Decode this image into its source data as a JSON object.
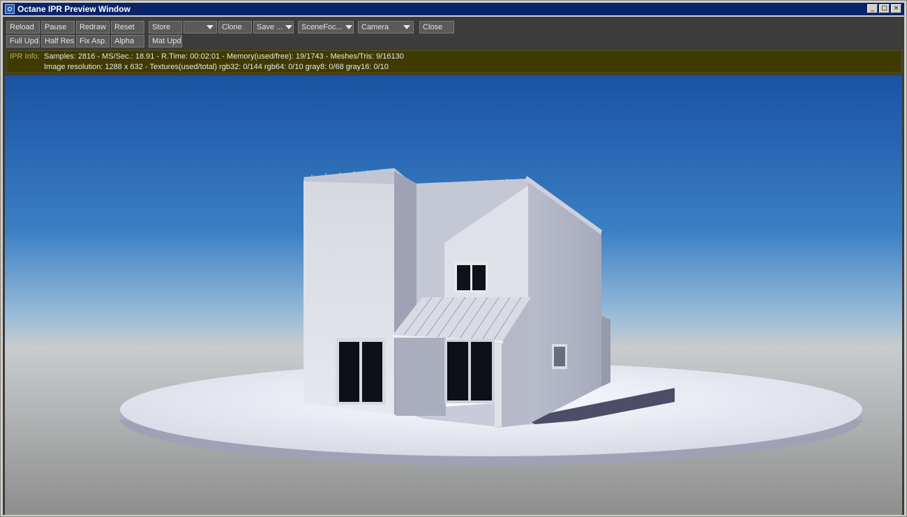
{
  "window": {
    "title": "Octane IPR Preview Window",
    "min_label": "_",
    "max_label": "□",
    "close_label": "×"
  },
  "toolbar": {
    "row1": {
      "reload": "Reload",
      "pause": "Pause",
      "redraw": "Redraw",
      "reset": "Reset",
      "store": "Store",
      "store_slot": "",
      "clone": "Clone",
      "save": "Save ...",
      "scene_focus": "SceneFoc...",
      "camera": "Camera",
      "close": "Close"
    },
    "row2": {
      "full_upd": "Full Upd.",
      "half_res": "Half Res",
      "fix_asp": "Fix Asp.",
      "alpha": "Alpha",
      "mat_upd": "Mat Upd"
    }
  },
  "info": {
    "label": "IPR Info:",
    "line1": "Samples: 2816  -  MS/Sec.: 18.91  -  R.Time: 00:02:01 - Memory(used/free): 19/1743  -  Meshes/Tris: 9/16130",
    "line2": "Image resolution: 1288 x 632 - Textures(used/total) rgb32: 0/144   rgb64: 0/10   gray8: 0/68   gray16: 0/10"
  },
  "colors": {
    "title_bar": "#0a246a",
    "info_bar": "#3f3a00",
    "sky_top": "#1a55a8",
    "sky_horizon": "#b0c6da",
    "ground": "#9a9a9a"
  }
}
